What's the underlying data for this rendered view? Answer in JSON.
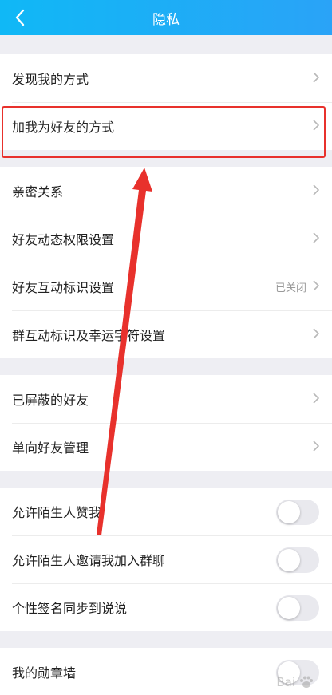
{
  "header": {
    "title": "隐私",
    "back_icon": "chevron-left-icon"
  },
  "groups": [
    {
      "items": [
        {
          "label": "发现我的方式",
          "type": "link"
        },
        {
          "label": "加我为好友的方式",
          "type": "link"
        }
      ]
    },
    {
      "items": [
        {
          "label": "亲密关系",
          "type": "link"
        },
        {
          "label": "好友动态权限设置",
          "type": "link"
        },
        {
          "label": "好友互动标识设置",
          "type": "link",
          "value": "已关闭"
        },
        {
          "label": "群互动标识及幸运字符设置",
          "type": "link"
        }
      ]
    },
    {
      "items": [
        {
          "label": "已屏蔽的好友",
          "type": "link"
        },
        {
          "label": "单向好友管理",
          "type": "link"
        }
      ]
    },
    {
      "items": [
        {
          "label": "允许陌生人赞我",
          "type": "toggle",
          "on": false
        },
        {
          "label": "允许陌生人邀请我加入群聊",
          "type": "toggle",
          "on": false
        },
        {
          "label": "个性签名同步到说说",
          "type": "toggle",
          "on": false
        }
      ]
    },
    {
      "items": [
        {
          "label": "我的勋章墙",
          "type": "toggle",
          "on": false
        }
      ]
    }
  ],
  "annotation": {
    "box_color": "#e8312c",
    "arrow_color": "#e8312c"
  },
  "watermark": {
    "text": "Bai"
  },
  "colors": {
    "header_start": "#10b8f6",
    "header_end": "#2aa3f7",
    "background": "#eeeef3"
  }
}
